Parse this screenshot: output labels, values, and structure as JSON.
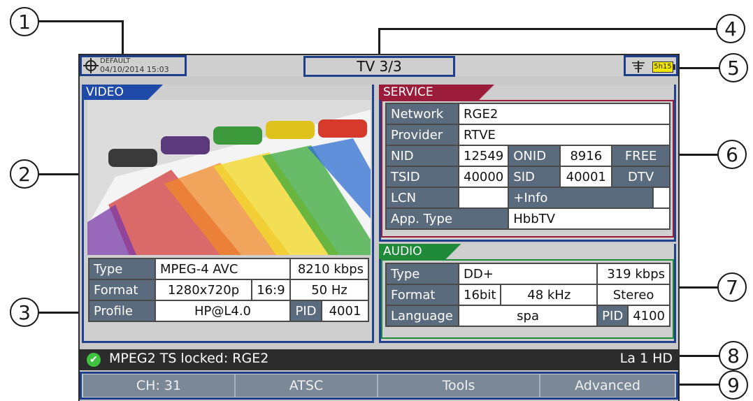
{
  "callouts": [
    "1",
    "2",
    "3",
    "4",
    "5",
    "6",
    "7",
    "8",
    "9"
  ],
  "topbar": {
    "preset": "DEFAULT",
    "datetime": "04/10/2014 15:03",
    "title": "TV 3/3",
    "battery": "5h15",
    "icons": [
      "target-icon",
      "antenna-icon",
      "battery-icon"
    ]
  },
  "video": {
    "tab": "VIDEO",
    "rows": {
      "type_label": "Type",
      "type_value": "MPEG-4 AVC",
      "bitrate": "8210 kbps",
      "format_label": "Format",
      "resolution": "1280x720p",
      "aspect": "16:9",
      "rate": "50 Hz",
      "profile_label": "Profile",
      "profile_value": "HP@L4.0",
      "pid_label": "PID",
      "pid_value": "4001"
    }
  },
  "service": {
    "tab": "SERVICE",
    "network_label": "Network",
    "network": "RGE2",
    "provider_label": "Provider",
    "provider": "RTVE",
    "nid_label": "NID",
    "nid": "12549",
    "onid_label": "ONID",
    "onid": "8916",
    "ca": "FREE",
    "tsid_label": "TSID",
    "tsid": "40000",
    "sid_label": "SID",
    "sid": "40001",
    "stype": "DTV",
    "lcn_label": "LCN",
    "lcn": "",
    "more": "+Info",
    "app_label": "App. Type",
    "app": "HbbTV"
  },
  "audio": {
    "tab": "AUDIO",
    "type_label": "Type",
    "type_value": "DD+",
    "bitrate": "319 kbps",
    "format_label": "Format",
    "bits": "16bit",
    "freq": "48 kHz",
    "mode": "Stereo",
    "lang_label": "Language",
    "lang": "spa",
    "pid_label": "PID",
    "pid_value": "4100"
  },
  "status": {
    "message": "MPEG2 TS locked: RGE2",
    "channel": "La 1 HD"
  },
  "menu": [
    "CH: 31",
    "ATSC",
    "Tools",
    "Advanced"
  ],
  "colors": {
    "panel_border": "#20418e",
    "video_tab": "#1f4aa8",
    "service_tab": "#9b1b3a",
    "audio_tab": "#1f8a3a",
    "status_bg": "#2c2c2c"
  }
}
